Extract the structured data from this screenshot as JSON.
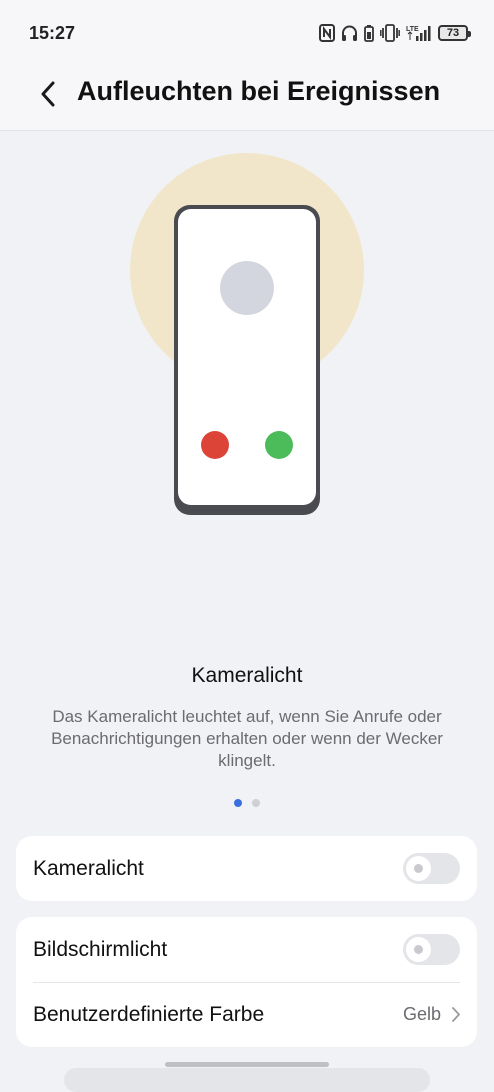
{
  "status_bar": {
    "time": "15:27",
    "battery_level": "73",
    "icons": [
      "nfc-icon",
      "headphones-icon",
      "battery-saver-icon",
      "vibrate-icon",
      "lte-signal-icon"
    ]
  },
  "header": {
    "back_icon": "chevron-left-icon",
    "title": "Aufleuchten bei Ereignissen"
  },
  "illustration": {
    "glow_color": "#f1e6c9",
    "phone_frame_color": "#4a4b50",
    "avatar_color": "#d3d6de",
    "decline_color": "#dc4438",
    "accept_color": "#4cbb5a"
  },
  "carousel": {
    "title": "Kameralicht",
    "description": "Das Kameralicht leuchtet auf, wenn Sie Anrufe oder Benachrichtigungen erhalten oder wenn der Wecker klingelt.",
    "page_count": 2,
    "active_page": 1,
    "active_color": "#3a6fe0"
  },
  "settings": {
    "camera_light": {
      "label": "Kameralicht",
      "enabled": false
    },
    "screen_light": {
      "label": "Bildschirmlicht",
      "enabled": false
    },
    "custom_color": {
      "label": "Benutzerdefinierte Farbe",
      "value": "Gelb"
    }
  }
}
